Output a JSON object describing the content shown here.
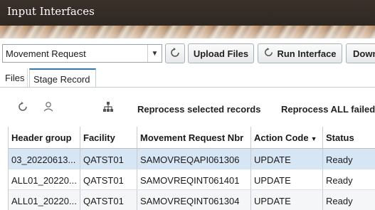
{
  "titlebar": {
    "title": "Input Interfaces"
  },
  "toolbar": {
    "interface_select_value": "Movement Request",
    "upload_label": "Upload Files",
    "run_label": "Run Interface",
    "download_label": "Down"
  },
  "tabs": [
    {
      "label": "Files",
      "selected": false
    },
    {
      "label": "Stage Record",
      "selected": true
    }
  ],
  "actions": {
    "reprocess_selected": "Reprocess selected records",
    "reprocess_all": "Reprocess ALL failed"
  },
  "table": {
    "columns": [
      "Header group",
      "Facility",
      "Movement Request Nbr",
      "Action Code",
      "Status"
    ],
    "rows": [
      [
        "03_20220613...",
        "QATST01",
        "SAMOVREQAPI061306",
        "UPDATE",
        "Ready"
      ],
      [
        "ALL01_20220...",
        "QATST01",
        "SAMOVREQINT061401",
        "UPDATE",
        "Ready"
      ],
      [
        "ALL01_20220...",
        "QATST01",
        "SAMOVREQINT061304",
        "UPDATE",
        "Ready"
      ]
    ]
  },
  "icons": {
    "refresh": "refresh-icon",
    "run": "refresh-icon",
    "dropdown": "chevron-down-icon",
    "row_refresh": "refresh-icon",
    "search_user": "search-user-icon",
    "hierarchy": "hierarchy-icon",
    "sort": "sort-desc-icon"
  },
  "colors": {
    "titlebar_bg": "#2f2722",
    "tab_accent": "#2b7bc1",
    "selected_row": "#d6e6f5"
  }
}
